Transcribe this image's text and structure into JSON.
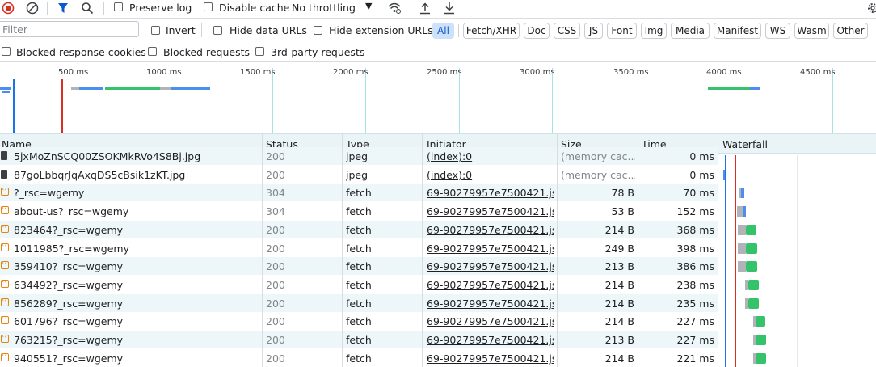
{
  "toolbar": {
    "preserve_log": "Preserve log",
    "disable_cache": "Disable cache",
    "throttling": "No throttling",
    "record_icon": "record-stop-icon",
    "clear_icon": "clear-icon",
    "filter_icon": "funnel-icon",
    "search_icon": "search-icon"
  },
  "filterbar": {
    "placeholder": "Filter",
    "invert": "Invert",
    "hide_data_urls": "Hide data URLs",
    "hide_extension_urls": "Hide extension URLs",
    "types": [
      "All",
      "Fetch/XHR",
      "Doc",
      "CSS",
      "JS",
      "Font",
      "Img",
      "Media",
      "Manifest",
      "WS",
      "Wasm",
      "Other"
    ],
    "active_type": "All"
  },
  "filterbar2": {
    "blocked_cookies": "Blocked response cookies",
    "blocked_requests": "Blocked requests",
    "third_party": "3rd-party requests"
  },
  "overview": {
    "ticks": [
      "500 ms",
      "1000 ms",
      "1500 ms",
      "2000 ms",
      "2500 ms",
      "3000 ms",
      "3500 ms",
      "4000 ms",
      "4500 ms"
    ]
  },
  "table": {
    "headers": [
      "Name",
      "Status",
      "Type",
      "Initiator",
      "Size",
      "Time",
      "Waterfall"
    ],
    "rows": [
      {
        "name": "5jxMoZnSCQ00ZSOKMkRVo4S8Bj.jpg",
        "status": "200",
        "type": "jpeg",
        "initiator": "(index):0",
        "size": "(memory cac...",
        "time": "0 ms",
        "kind": "img"
      },
      {
        "name": "87goLbbqrJqAxqDS5cBsik1zKT.jpg",
        "status": "200",
        "type": "jpeg",
        "initiator": "(index):0",
        "size": "(memory cac...",
        "time": "0 ms",
        "kind": "img"
      },
      {
        "name": "?_rsc=wgemy",
        "status": "304",
        "type": "fetch",
        "initiator": "69-90279957e7500421.js:1",
        "size": "78 B",
        "time": "70 ms",
        "kind": "fetch"
      },
      {
        "name": "about-us?_rsc=wgemy",
        "status": "304",
        "type": "fetch",
        "initiator": "69-90279957e7500421.js:1",
        "size": "53 B",
        "time": "152 ms",
        "kind": "fetch"
      },
      {
        "name": "823464?_rsc=wgemy",
        "status": "200",
        "type": "fetch",
        "initiator": "69-90279957e7500421.js:1",
        "size": "214 B",
        "time": "368 ms",
        "kind": "fetch"
      },
      {
        "name": "1011985?_rsc=wgemy",
        "status": "200",
        "type": "fetch",
        "initiator": "69-90279957e7500421.js:1",
        "size": "249 B",
        "time": "398 ms",
        "kind": "fetch"
      },
      {
        "name": "359410?_rsc=wgemy",
        "status": "200",
        "type": "fetch",
        "initiator": "69-90279957e7500421.js:1",
        "size": "213 B",
        "time": "386 ms",
        "kind": "fetch"
      },
      {
        "name": "634492?_rsc=wgemy",
        "status": "200",
        "type": "fetch",
        "initiator": "69-90279957e7500421.js:1",
        "size": "214 B",
        "time": "238 ms",
        "kind": "fetch"
      },
      {
        "name": "856289?_rsc=wgemy",
        "status": "200",
        "type": "fetch",
        "initiator": "69-90279957e7500421.js:1",
        "size": "214 B",
        "time": "235 ms",
        "kind": "fetch"
      },
      {
        "name": "601796?_rsc=wgemy",
        "status": "200",
        "type": "fetch",
        "initiator": "69-90279957e7500421.js:1",
        "size": "214 B",
        "time": "227 ms",
        "kind": "fetch"
      },
      {
        "name": "763215?_rsc=wgemy",
        "status": "200",
        "type": "fetch",
        "initiator": "69-90279957e7500421.js:1",
        "size": "213 B",
        "time": "227 ms",
        "kind": "fetch"
      },
      {
        "name": "940551?_rsc=wgemy",
        "status": "200",
        "type": "fetch",
        "initiator": "69-90279957e7500421.js:1",
        "size": "214 B",
        "time": "221 ms",
        "kind": "fetch"
      }
    ]
  },
  "colors": {
    "accent": "#1a73e8",
    "active_chip_bg": "#cde1fb",
    "row_alt": "#edf6f8",
    "waterfall_green": "#34c36a",
    "waterfall_blue": "#4b8ef0",
    "waterfall_grey": "#b0b4b8",
    "load_line_red": "#d93025"
  }
}
